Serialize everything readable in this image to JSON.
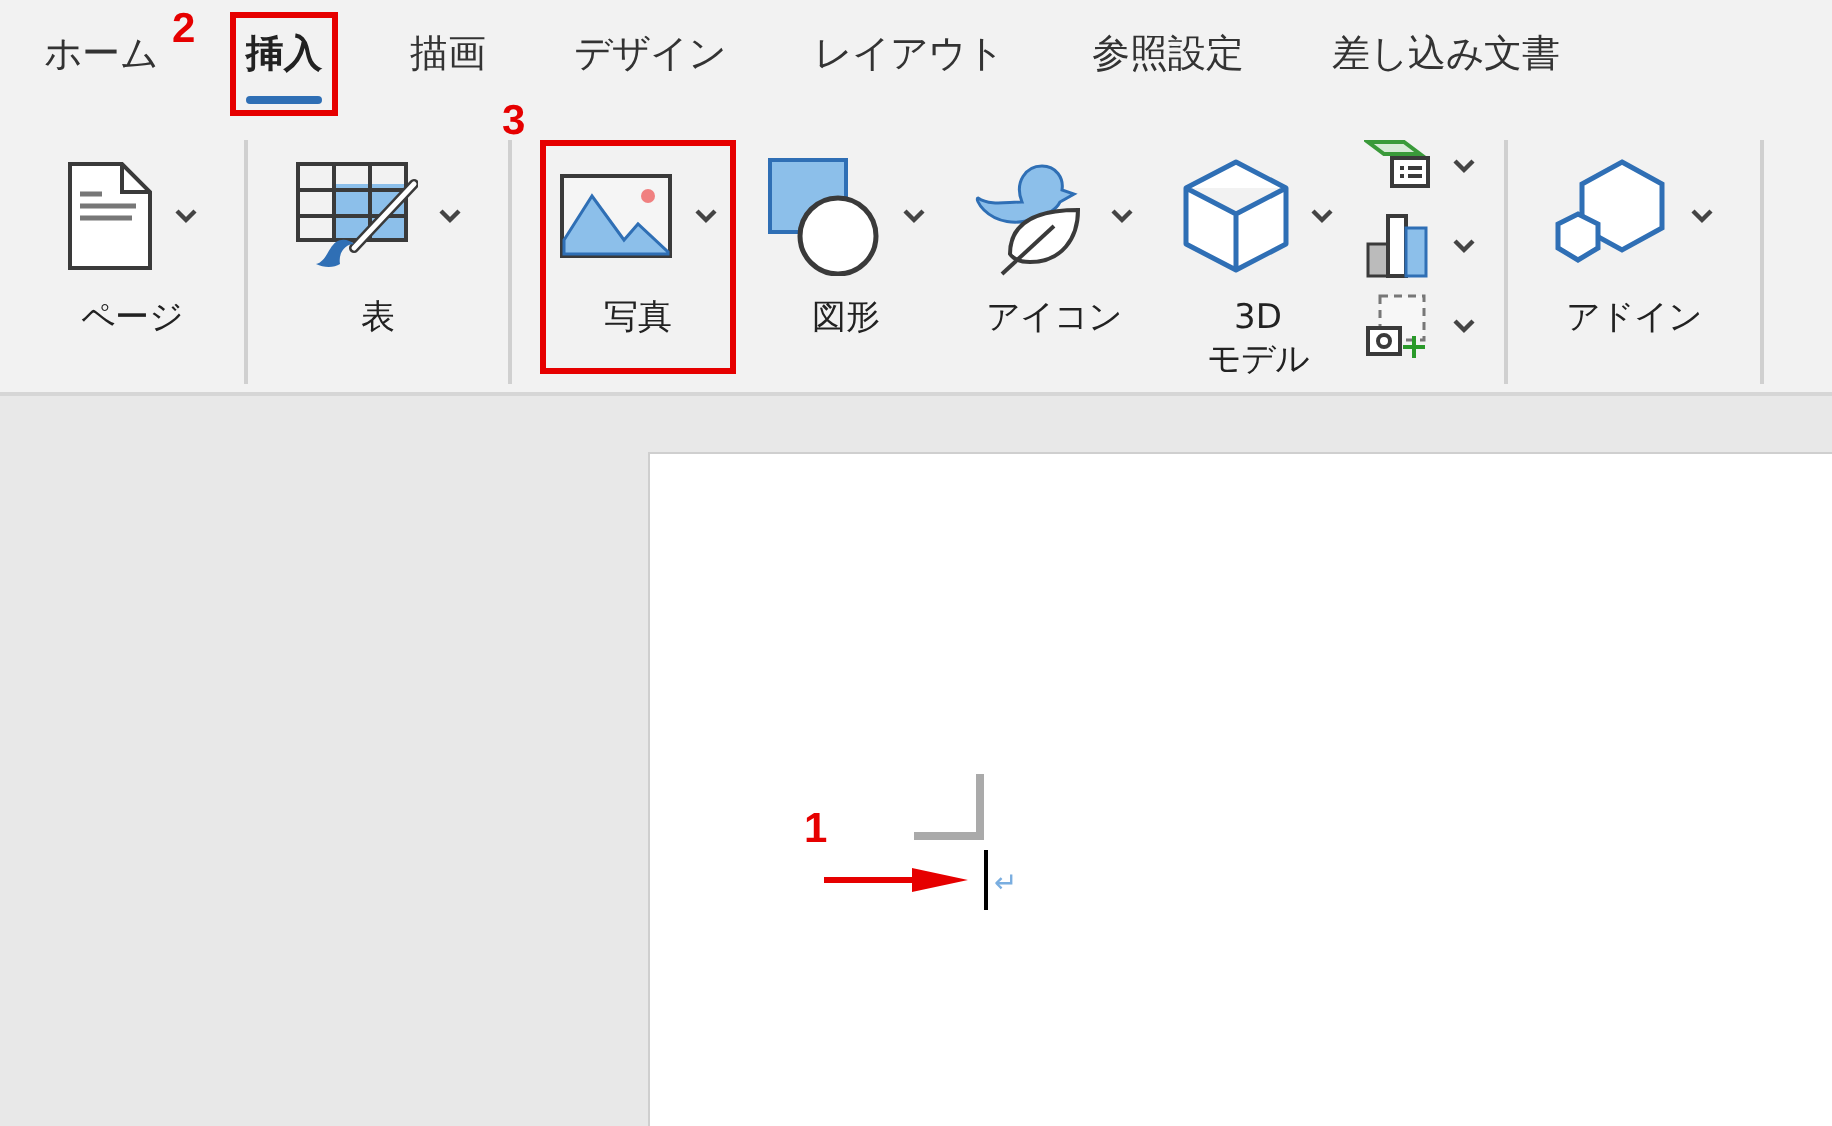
{
  "tabs": [
    {
      "label": "ホーム",
      "selected": false,
      "highlighted": false
    },
    {
      "label": "挿入",
      "selected": true,
      "highlighted": true,
      "callout": "2"
    },
    {
      "label": "描画",
      "selected": false,
      "highlighted": false
    },
    {
      "label": "デザイン",
      "selected": false,
      "highlighted": false
    },
    {
      "label": "レイアウト",
      "selected": false,
      "highlighted": false
    },
    {
      "label": "参照設定",
      "selected": false,
      "highlighted": false
    },
    {
      "label": "差し込み文書",
      "selected": false,
      "highlighted": false
    }
  ],
  "ribbon_groups": [
    {
      "buttons": [
        {
          "kind": "page",
          "label": "ページ",
          "highlighted": false
        }
      ]
    },
    {
      "buttons": [
        {
          "kind": "table",
          "label": "表",
          "highlighted": false
        }
      ]
    },
    {
      "buttons": [
        {
          "kind": "pictures",
          "label": "写真",
          "highlighted": true,
          "callout": "3"
        },
        {
          "kind": "shapes",
          "label": "図形",
          "highlighted": false
        },
        {
          "kind": "icons",
          "label": "アイコン",
          "highlighted": false
        },
        {
          "kind": "model3d",
          "label": "3D\nモデル",
          "highlighted": false
        },
        {
          "kind": "stack",
          "items": [
            {
              "kind": "smartart"
            },
            {
              "kind": "chart"
            },
            {
              "kind": "screenshot"
            }
          ]
        }
      ]
    },
    {
      "buttons": [
        {
          "kind": "addins",
          "label": "アドイン",
          "highlighted": false
        }
      ]
    }
  ],
  "document": {
    "paragraph_mark": "↵",
    "callout": "1"
  }
}
